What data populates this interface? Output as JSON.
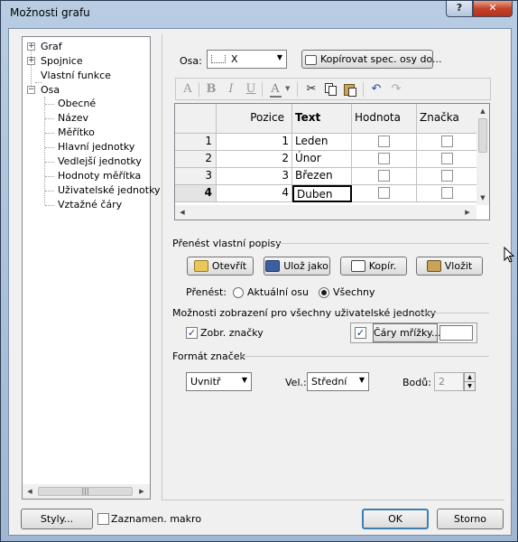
{
  "window": {
    "title": "Možnosti grafu"
  },
  "tree": {
    "items": [
      {
        "label": "Graf",
        "expander": "+"
      },
      {
        "label": "Spojnice",
        "expander": "+"
      },
      {
        "label": "Vlastní funkce",
        "expander": ""
      },
      {
        "label": "Osa",
        "expander": "−"
      },
      {
        "label": "Obecné"
      },
      {
        "label": "Název"
      },
      {
        "label": "Měřítko"
      },
      {
        "label": "Hlavní jednotky"
      },
      {
        "label": "Vedlejší jednotky"
      },
      {
        "label": "Hodnoty měřítka"
      },
      {
        "label": "Uživatelské jednotky"
      },
      {
        "label": "Vztažné čáry"
      }
    ]
  },
  "axis": {
    "label": "Osa:",
    "value": "X",
    "copy_button": "Kopírovat spec. osy do..."
  },
  "grid": {
    "headers": [
      "",
      "Pozice",
      "Text",
      "Hodnota",
      "Značka"
    ],
    "rows": [
      {
        "num": "1",
        "pozice": "1",
        "text": "Leden"
      },
      {
        "num": "2",
        "pozice": "2",
        "text": "Únor"
      },
      {
        "num": "3",
        "pozice": "3",
        "text": "Březen"
      },
      {
        "num": "4",
        "pozice": "4",
        "text": "Duben"
      }
    ]
  },
  "transfer": {
    "title": "Přenést vlastní popisy",
    "open_button": "Otevřít",
    "save_button": "Ulož jako",
    "copy_button": "Kopír.",
    "paste_button": "Vložit",
    "transfer_label": "Přenést:",
    "current_axis": "Aktuální osu",
    "all": "Všechny",
    "selected": "all"
  },
  "display": {
    "title": "Možnosti zobrazení pro všechny uživatelské jednotky",
    "show_marks": "Zobr. značky",
    "show_marks_checked": true,
    "grid_lines": "Čáry mřížky...",
    "grid_lines_checked": true
  },
  "marks": {
    "title": "Formát značek",
    "position": "Uvnitř",
    "size_label": "Vel.:",
    "size": "Střední",
    "points_label": "Bodů:",
    "points": "2"
  },
  "footer": {
    "styles_button": "Styly...",
    "record_macro": "Zaznamen. makro",
    "record_macro_checked": false,
    "ok_button": "OK",
    "cancel_button": "Storno"
  }
}
